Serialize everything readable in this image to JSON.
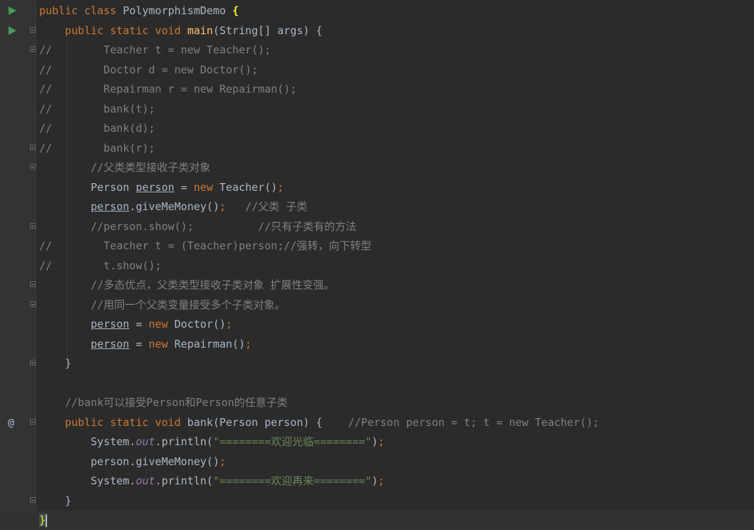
{
  "editor": {
    "lines": [
      {
        "code": [
          [
            "kw",
            "public class "
          ],
          [
            "plain",
            "PolymorphismDemo "
          ],
          [
            "brace",
            "{"
          ]
        ],
        "run": true
      },
      {
        "code": [
          [
            "plain",
            "    "
          ],
          [
            "kw",
            "public static void "
          ],
          [
            "fn",
            "main"
          ],
          [
            "plain",
            "(String[] args) {"
          ]
        ],
        "run": true,
        "fold": true
      },
      {
        "code": [
          [
            "cm",
            "//        Teacher t = new Teacher();"
          ]
        ],
        "fold": true
      },
      {
        "code": [
          [
            "cm",
            "//        Doctor d = new Doctor();"
          ]
        ]
      },
      {
        "code": [
          [
            "cm",
            "//        Repairman r = new Repairman();"
          ]
        ]
      },
      {
        "code": [
          [
            "cm",
            "//        bank(t);"
          ]
        ]
      },
      {
        "code": [
          [
            "cm",
            "//        bank(d);"
          ]
        ]
      },
      {
        "code": [
          [
            "cm",
            "//        bank(r);"
          ]
        ],
        "fold": true
      },
      {
        "code": [
          [
            "plain",
            "        "
          ],
          [
            "cm",
            "//父类类型接收子类对象"
          ]
        ],
        "fold": true
      },
      {
        "code": [
          [
            "plain",
            "        Person "
          ],
          [
            "ul",
            "person"
          ],
          [
            "plain",
            " = "
          ],
          [
            "kw",
            "new "
          ],
          [
            "plain",
            "Teacher()"
          ],
          [
            "kw",
            ";"
          ]
        ]
      },
      {
        "code": [
          [
            "plain",
            "        "
          ],
          [
            "ul",
            "person"
          ],
          [
            "plain",
            ".giveMeMoney()"
          ],
          [
            "kw",
            ";   "
          ],
          [
            "cm",
            "//父类 子类"
          ]
        ]
      },
      {
        "code": [
          [
            "plain",
            "        "
          ],
          [
            "cm",
            "//person.show();          //只有子类有的方法"
          ]
        ],
        "fold": true
      },
      {
        "code": [
          [
            "cm",
            "//        Teacher t = (Teacher)person;//强转，向下转型"
          ]
        ]
      },
      {
        "code": [
          [
            "cm",
            "//        t.show();"
          ]
        ]
      },
      {
        "code": [
          [
            "plain",
            "        "
          ],
          [
            "cm",
            "//多态优点，父类类型接收子类对象 扩展性变强。"
          ]
        ],
        "fold": true
      },
      {
        "code": [
          [
            "plain",
            "        "
          ],
          [
            "cm",
            "//用同一个父类变量接受多个子类对象。"
          ]
        ],
        "fold": true
      },
      {
        "code": [
          [
            "plain",
            "        "
          ],
          [
            "ul",
            "person"
          ],
          [
            "plain",
            " = "
          ],
          [
            "kw",
            "new "
          ],
          [
            "plain",
            "Doctor()"
          ],
          [
            "kw",
            ";"
          ]
        ]
      },
      {
        "code": [
          [
            "plain",
            "        "
          ],
          [
            "ul",
            "person"
          ],
          [
            "plain",
            " = "
          ],
          [
            "kw",
            "new "
          ],
          [
            "plain",
            "Repairman()"
          ],
          [
            "kw",
            ";"
          ]
        ]
      },
      {
        "code": [
          [
            "plain",
            "    }"
          ]
        ],
        "fold": true
      },
      {
        "code": []
      },
      {
        "code": [
          [
            "plain",
            "    "
          ],
          [
            "cm",
            "//bank可以接受Person和Person的任意子类"
          ]
        ]
      },
      {
        "code": [
          [
            "plain",
            "    "
          ],
          [
            "kw",
            "public static void "
          ],
          [
            "plainmuted",
            "bank"
          ],
          [
            "plain",
            "(Person person) {    "
          ],
          [
            "cm",
            "//Person person = t; t = new Teacher();"
          ]
        ],
        "override": true,
        "fold": true
      },
      {
        "code": [
          [
            "plain",
            "        System."
          ],
          [
            "st",
            "out"
          ],
          [
            "plain",
            ".println("
          ],
          [
            "str",
            "\"========欢迎光临========\""
          ],
          [
            "plain",
            ")"
          ],
          [
            "kw",
            ";"
          ]
        ]
      },
      {
        "code": [
          [
            "plain",
            "        person.giveMeMoney()"
          ],
          [
            "kw",
            ";"
          ]
        ]
      },
      {
        "code": [
          [
            "plain",
            "        System."
          ],
          [
            "st",
            "out"
          ],
          [
            "plain",
            ".println("
          ],
          [
            "str",
            "\"========欢迎再来========\""
          ],
          [
            "plain",
            ")"
          ],
          [
            "kw",
            ";"
          ]
        ]
      },
      {
        "code": [
          [
            "plain",
            "    }"
          ]
        ],
        "fold": true
      },
      {
        "code": [
          [
            "lastbrace",
            "}"
          ]
        ],
        "current": true
      }
    ]
  },
  "gutter": {
    "run_icon": "run-triangle-icon",
    "fold_icon": "fold-marker-icon",
    "override_icon": "@",
    "colors": {
      "keyword": "#cc7832",
      "string": "#6a8759",
      "comment": "#808080",
      "static_field": "#9876aa",
      "method": "#ffc66d",
      "text": "#a9b7c6",
      "background": "#2b2b2b"
    }
  }
}
